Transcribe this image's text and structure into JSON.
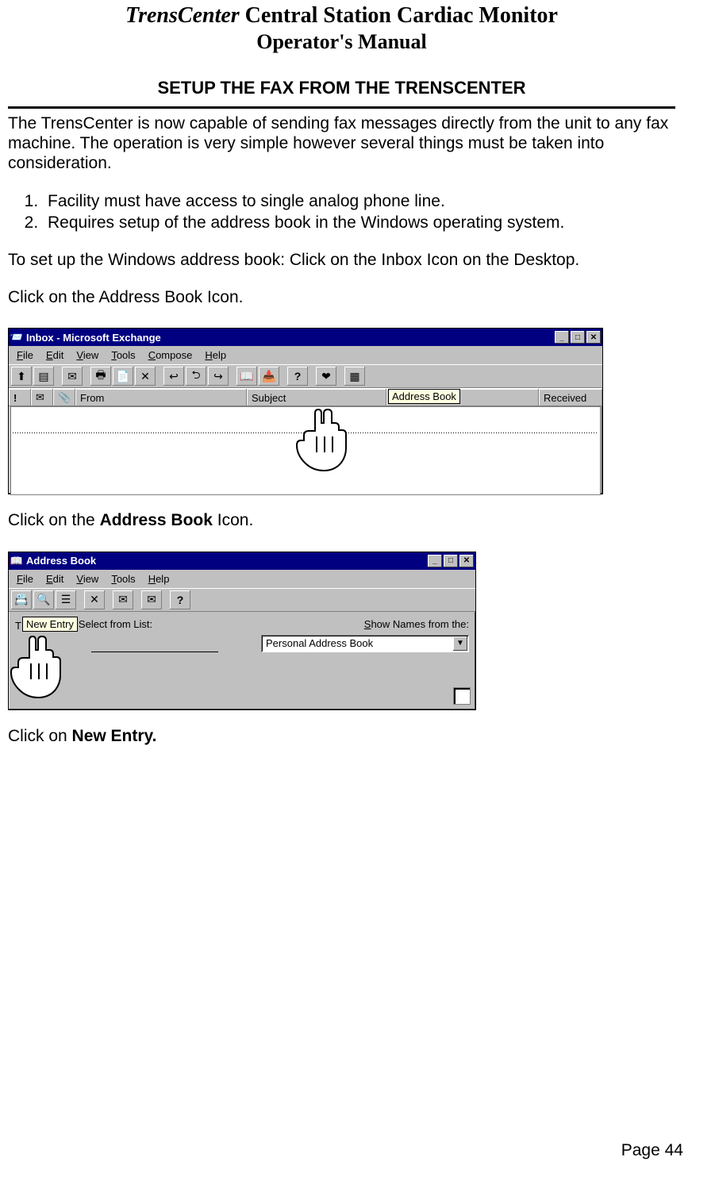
{
  "header": {
    "brand": "TrensCenter",
    "title_rest": " Central Station Cardiac Monitor",
    "subtitle": "Operator's Manual"
  },
  "section_title": "SETUP THE FAX FROM THE TRENSCENTER",
  "intro": "The TrensCenter is now capable of sending fax messages directly from the unit to any fax machine.  The operation is very simple however several things must be taken into consideration.",
  "numbered": [
    "Facility must have access to single analog phone line.",
    "Requires setup of the address book in the Windows operating system."
  ],
  "instr1": "To set up the Windows address book: Click on the Inbox Icon on the Desktop.",
  "instr2": "Click on the Address Book Icon.",
  "instr3_pre": "Click on the ",
  "instr3_bold": "Address Book",
  "instr3_post": " Icon.",
  "instr4_pre": "Click on ",
  "instr4_bold": "New Entry.",
  "page_number": "Page 44",
  "screenshot1": {
    "title": "Inbox - Microsoft Exchange",
    "menus": {
      "file": "File",
      "edit": "Edit",
      "view": "View",
      "tools": "Tools",
      "compose": "Compose",
      "help": "Help"
    },
    "columns": {
      "from": "From",
      "subject": "Subject",
      "received": "Received"
    },
    "tooltip": "Address Book"
  },
  "screenshot2": {
    "title": "Address Book",
    "menus": {
      "file": "File",
      "edit": "Edit",
      "view": "View",
      "tools": "Tools",
      "help": "Help"
    },
    "label_left": "ype Name or Select from List:",
    "label_right": "Show Names from the:",
    "dropdown_value": "Personal Address Book",
    "tooltip": "New Entry"
  }
}
